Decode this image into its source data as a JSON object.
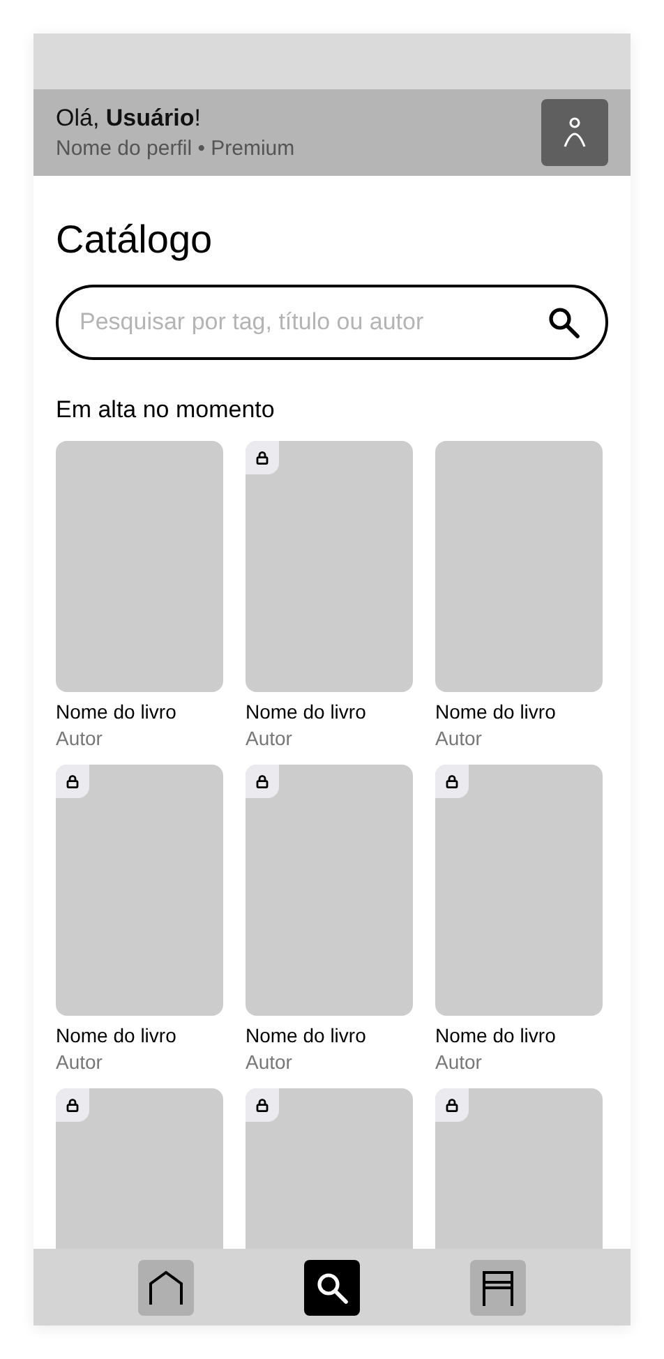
{
  "header": {
    "greeting": "Olá, **Usuário**!",
    "subtitle": "Nome do perfil • Premium"
  },
  "page_title": "Catálogo",
  "search": {
    "placeholder": "Pesquisar por tag, título ou autor"
  },
  "section_title": "Em alta no momento",
  "books": [
    {
      "title": "Nome do livro",
      "author": "Autor",
      "locked": false
    },
    {
      "title": "Nome do livro",
      "author": "Autor",
      "locked": true
    },
    {
      "title": "Nome do livro",
      "author": "Autor",
      "locked": false
    },
    {
      "title": "Nome do livro",
      "author": "Autor",
      "locked": true
    },
    {
      "title": "Nome do livro",
      "author": "Autor",
      "locked": true
    },
    {
      "title": "Nome do livro",
      "author": "Autor",
      "locked": true
    },
    {
      "locked": true
    },
    {
      "locked": true
    },
    {
      "locked": true
    }
  ],
  "nav": [
    {
      "kind": "home",
      "selected": false
    },
    {
      "kind": "search",
      "selected": true
    },
    {
      "kind": "library",
      "selected": false
    }
  ]
}
